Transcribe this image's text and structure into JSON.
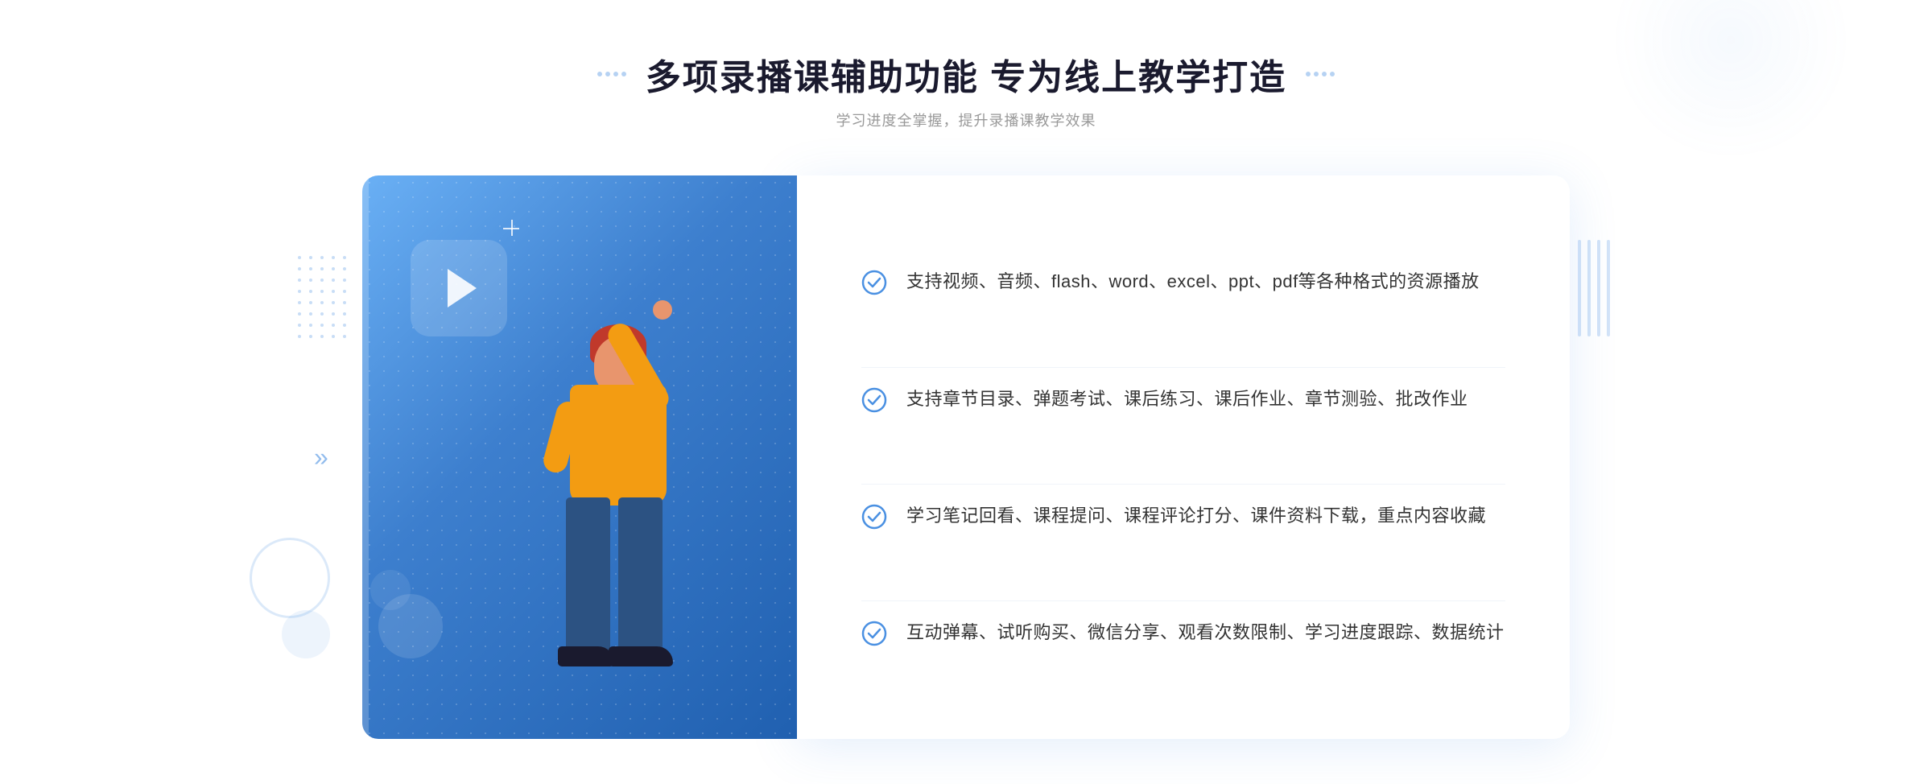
{
  "header": {
    "title": "多项录播课辅助功能 专为线上教学打造",
    "subtitle": "学习进度全掌握，提升录播课教学效果",
    "title_dots_left": "decorative",
    "title_dots_right": "decorative"
  },
  "features": [
    {
      "id": 1,
      "text": "支持视频、音频、flash、word、excel、ppt、pdf等各种格式的资源播放"
    },
    {
      "id": 2,
      "text": "支持章节目录、弹题考试、课后练习、课后作业、章节测验、批改作业"
    },
    {
      "id": 3,
      "text": "学习笔记回看、课程提问、课程评论打分、课件资料下载，重点内容收藏"
    },
    {
      "id": 4,
      "text": "互动弹幕、试听购买、微信分享、观看次数限制、学习进度跟踪、数据统计"
    }
  ],
  "colors": {
    "primary": "#3d7fce",
    "accent": "#4a90e2",
    "title_dark": "#1a1a2e",
    "subtitle_gray": "#999999",
    "text_dark": "#333333",
    "check_color": "#4a90e2"
  },
  "decorative": {
    "left_chevrons": "»",
    "play_icon": "▶"
  }
}
